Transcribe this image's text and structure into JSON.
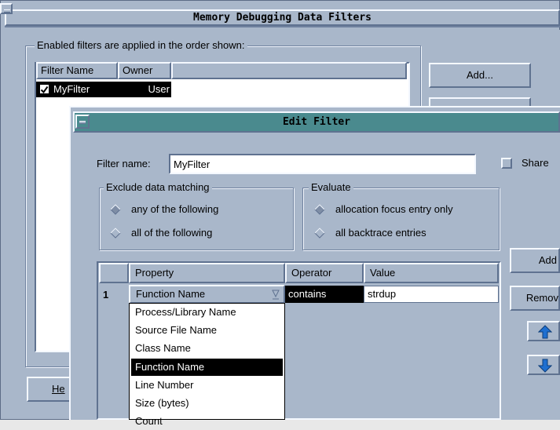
{
  "main_window": {
    "title": "Memory Debugging Data Filters",
    "group_label": "Enabled filters are applied in the order shown:",
    "columns": [
      "Filter Name",
      "Owner"
    ],
    "filters": [
      {
        "checked": true,
        "name": "MyFilter",
        "owner": "User"
      }
    ],
    "add_button": "Add...",
    "help_button": "He"
  },
  "edit_dialog": {
    "title": "Edit Filter",
    "filter_name_label": "Filter name:",
    "filter_name_value": "MyFilter",
    "share_label": "Share",
    "share_checked": false,
    "exclude_group": {
      "title": "Exclude data matching",
      "options": [
        "any of the following",
        "all of the following"
      ],
      "selected_index": 0
    },
    "evaluate_group": {
      "title": "Evaluate",
      "options": [
        "allocation focus entry only",
        "all backtrace entries"
      ],
      "selected_index": 0
    },
    "table": {
      "columns": [
        "Property",
        "Operator",
        "Value"
      ],
      "rows": [
        {
          "index": "1",
          "property": "Function Name",
          "operator": "contains",
          "value": "strdup"
        }
      ]
    },
    "dropdown_options": [
      "Process/Library Name",
      "Source File Name",
      "Class Name",
      "Function Name",
      "Line Number",
      "Size (bytes)",
      "Count"
    ],
    "dropdown_selected": "Function Name",
    "side_buttons": {
      "add": "Add",
      "remove": "Remov"
    },
    "icons": {
      "move_up": "arrow-up-icon",
      "move_down": "arrow-down-icon"
    },
    "colors": {
      "titlebar_active": "#4a8a8e",
      "window_bg": "#a9b7ca",
      "arrow_fill": "#1e6fd0"
    }
  }
}
